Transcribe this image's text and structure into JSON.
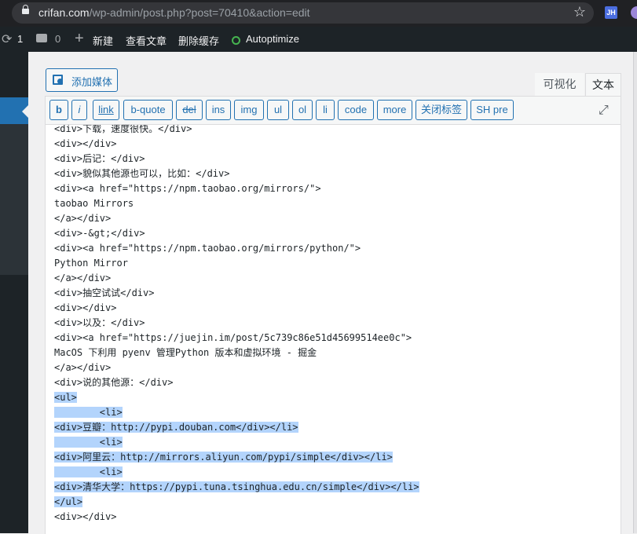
{
  "browser": {
    "url_host": "crifan.com",
    "url_path": "/wp-admin/post.php?post=70410&action=edit",
    "extension_label": "JH"
  },
  "adminbar": {
    "update_count": "1",
    "comment_count": "0",
    "new_label": "新建",
    "view_label": "查看文章",
    "cache_label": "删除缓存",
    "plugin_label": "Autoptimize"
  },
  "editor": {
    "add_media": "添加媒体",
    "tab_visual": "可视化",
    "tab_text": "文本",
    "quicktags": [
      "b",
      "i",
      "link",
      "b-quote",
      "del",
      "ins",
      "img",
      "ul",
      "ol",
      "li",
      "code",
      "more",
      "关闭标签",
      "SH pre"
    ],
    "content_lines": [
      "<div>下载，速度很快。</div>",
      "<div></div>",
      "<div>后记：</div>",
      "<div>貌似其他源也可以，比如：</div>",
      "<div><a href=\"https://npm.taobao.org/mirrors/\">",
      "taobao Mirrors",
      "</a></div>",
      "<div>-&gt;</div>",
      "<div><a href=\"https://npm.taobao.org/mirrors/python/\">",
      "Python Mirror",
      "</a></div>",
      "<div>抽空试试</div>",
      "<div></div>",
      "<div>以及：</div>",
      "<div><a href=\"https://juejin.im/post/5c739c86e51d45699514ee0c\">",
      "MacOS 下利用 pyenv 管理Python 版本和虚拟环境 - 掘金",
      "</a></div>",
      "<div>说的其他源：</div>",
      "<ul>",
      "        <li>",
      "<div>豆瓣：http://pypi.douban.com</div></li>",
      "        <li>",
      "<div>阿里云：http://mirrors.aliyun.com/pypi/simple</div></li>",
      "        <li>",
      "<div>清华大学：https://pypi.tuna.tsinghua.edu.cn/simple</div></li>",
      "</ul>",
      "<div></div>"
    ],
    "selected_from": 18,
    "selected_to": 25
  }
}
